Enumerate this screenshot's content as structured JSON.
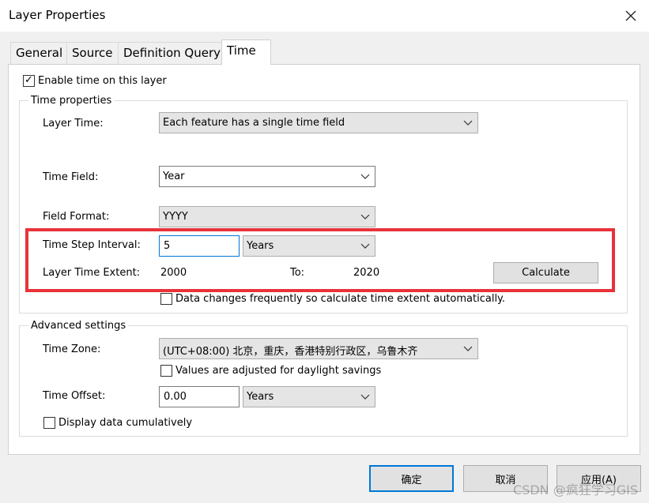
{
  "window": {
    "title": "Layer Properties"
  },
  "tabs": [
    {
      "label": "General"
    },
    {
      "label": "Source"
    },
    {
      "label": "Definition Query"
    },
    {
      "label": "Time"
    }
  ],
  "enable_time": {
    "label": "Enable time on this layer",
    "checked": true
  },
  "time_properties": {
    "group_label": "Time properties",
    "layer_time": {
      "label": "Layer Time:",
      "value": "Each feature has a single time field"
    },
    "time_field": {
      "label": "Time Field:",
      "value": "Year"
    },
    "field_format": {
      "label": "Field Format:",
      "value": "YYYY"
    },
    "step_interval": {
      "label": "Time Step Interval:",
      "value": "5",
      "unit": "Years"
    },
    "extent": {
      "label": "Layer Time Extent:",
      "from": "2000",
      "to_label": "To:",
      "to": "2020"
    },
    "calculate_label": "Calculate",
    "auto_calc": {
      "label": "Data changes frequently so calculate time extent automatically.",
      "checked": false
    }
  },
  "advanced": {
    "group_label": "Advanced settings",
    "time_zone": {
      "label": "Time Zone:",
      "value": "(UTC+08:00) 北京，重庆，香港特别行政区，乌鲁木齐"
    },
    "daylight": {
      "label": "Values are adjusted for daylight savings",
      "checked": false
    },
    "time_offset": {
      "label": "Time Offset:",
      "value": "0.00",
      "unit": "Years"
    },
    "cumulative": {
      "label": "Display data cumulatively",
      "checked": false
    }
  },
  "footer": {
    "ok_label": "确定",
    "cancel_label": "取消",
    "apply_label": "应用(A)"
  },
  "watermark": "CSDN @疯狂学习GIS",
  "colors": {
    "highlight": "#e8323a",
    "focus": "#0078d7"
  }
}
